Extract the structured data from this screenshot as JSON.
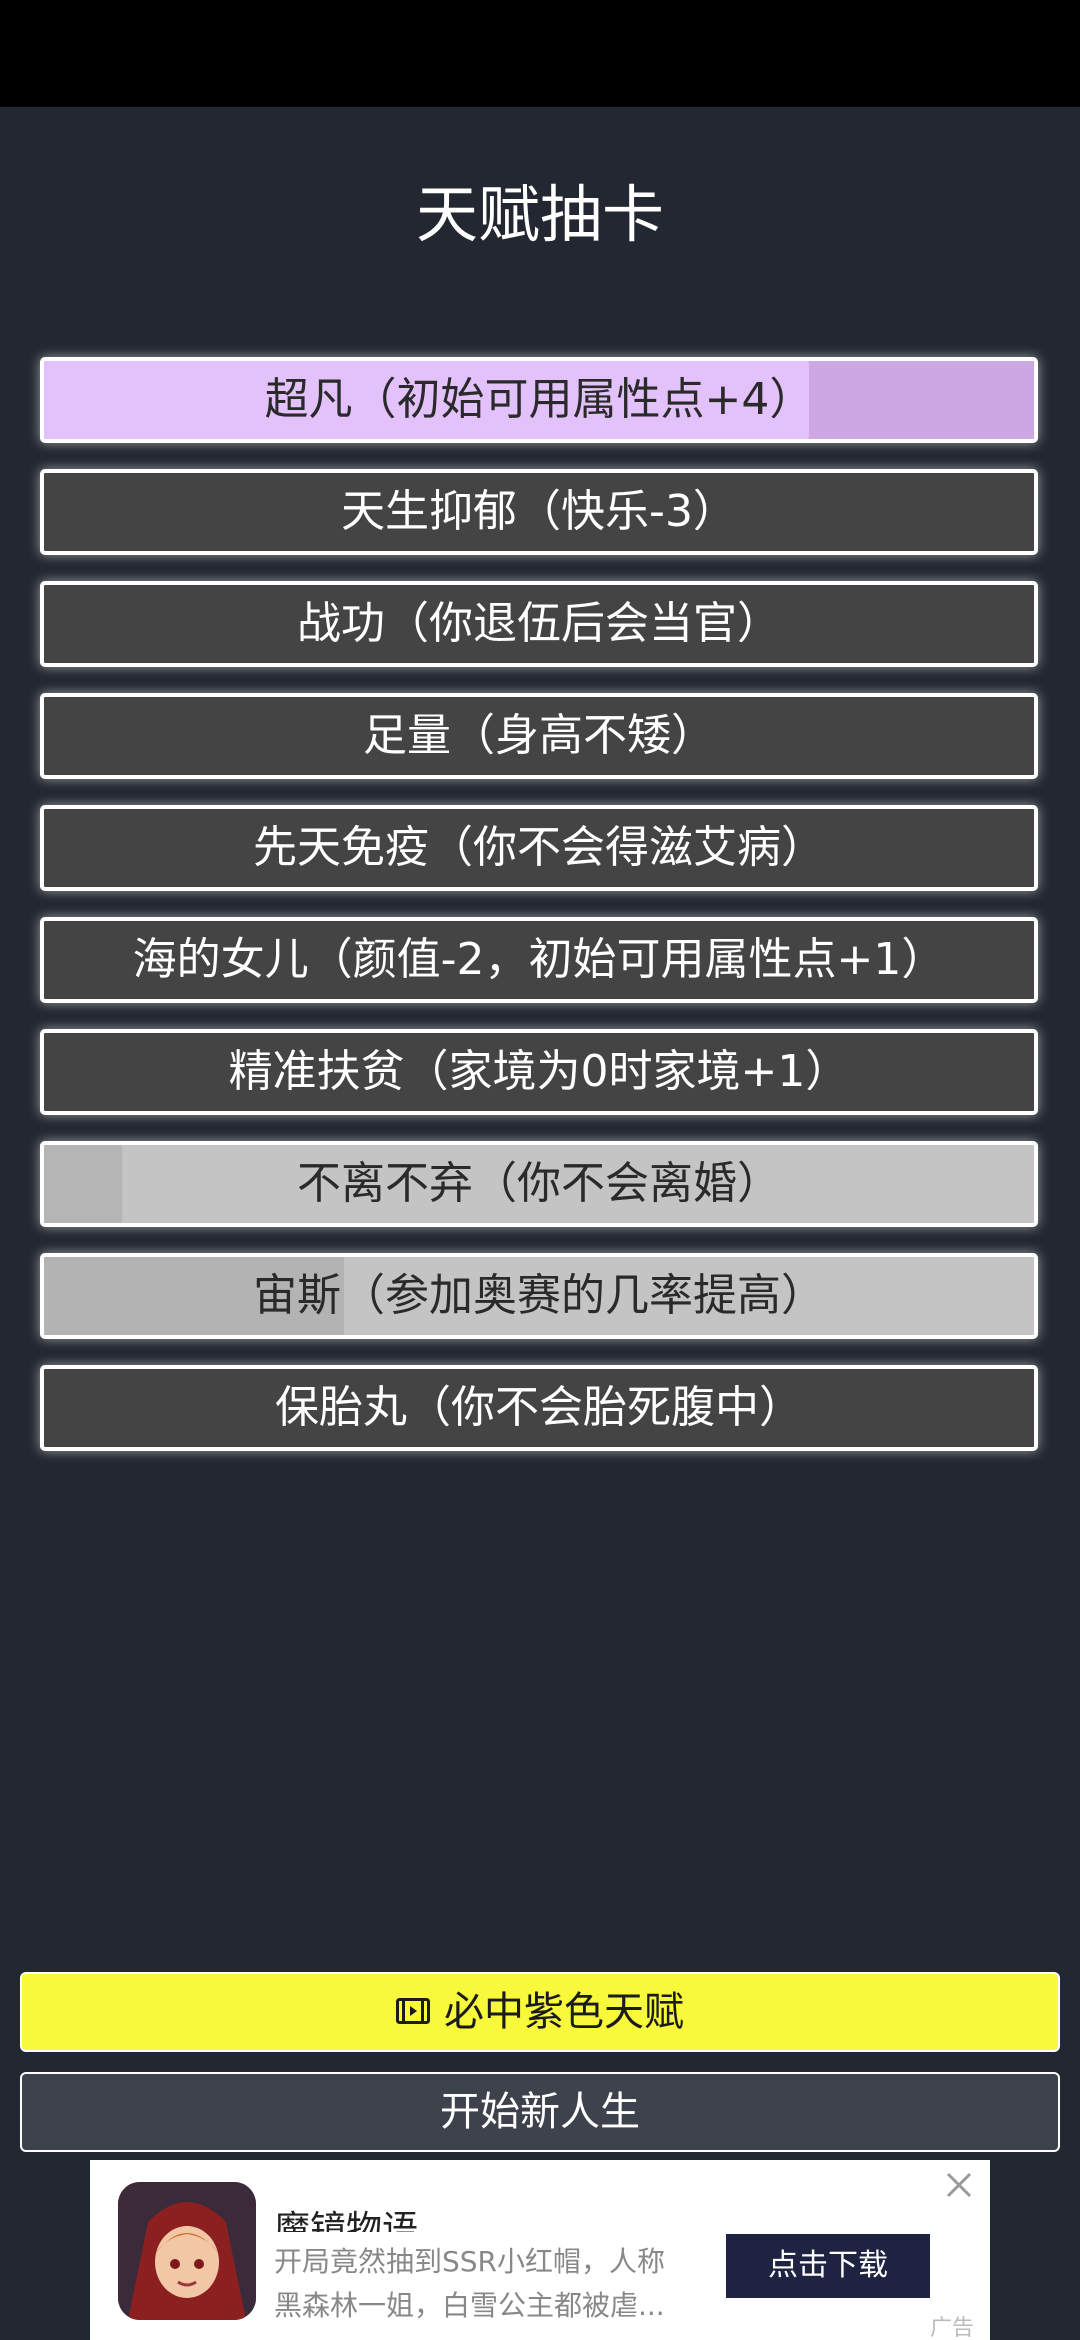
{
  "header": {
    "title": "天赋抽卡"
  },
  "talents": [
    {
      "label": "超凡（初始可用属性点+4）",
      "tier": "purple"
    },
    {
      "label": "天生抑郁（快乐-3）",
      "tier": "normal"
    },
    {
      "label": "战功（你退伍后会当官）",
      "tier": "normal"
    },
    {
      "label": "足量（身高不矮）",
      "tier": "normal"
    },
    {
      "label": "先天免疫（你不会得滋艾病）",
      "tier": "normal"
    },
    {
      "label": "海的女儿（颜值-2，初始可用属性点+1）",
      "tier": "normal"
    },
    {
      "label": "精准扶贫（家境为0时家境+1）",
      "tier": "normal"
    },
    {
      "label": "不离不弃（你不会离婚）",
      "tier": "gray"
    },
    {
      "label": "宙斯（参加奥赛的几率提高）",
      "tier": "gray"
    },
    {
      "label": "保胎丸（你不会胎死腹中）",
      "tier": "normal"
    }
  ],
  "actions": {
    "purple_label": "必中紫色天赋",
    "new_life_label": "开始新人生"
  },
  "ad": {
    "title": "魔镜物语",
    "desc_line1": "开局竟然抽到SSR小红帽，人称",
    "desc_line2": "黑森林一姐，白雪公主都被虐...",
    "cta": "点击下载",
    "badge": "广告"
  },
  "colors": {
    "background": "#222731",
    "purple_tier": "#e3c2fb",
    "gray_tier": "#c4c4c4",
    "normal_tier": "#444444",
    "primary_button": "#f8f93a"
  }
}
